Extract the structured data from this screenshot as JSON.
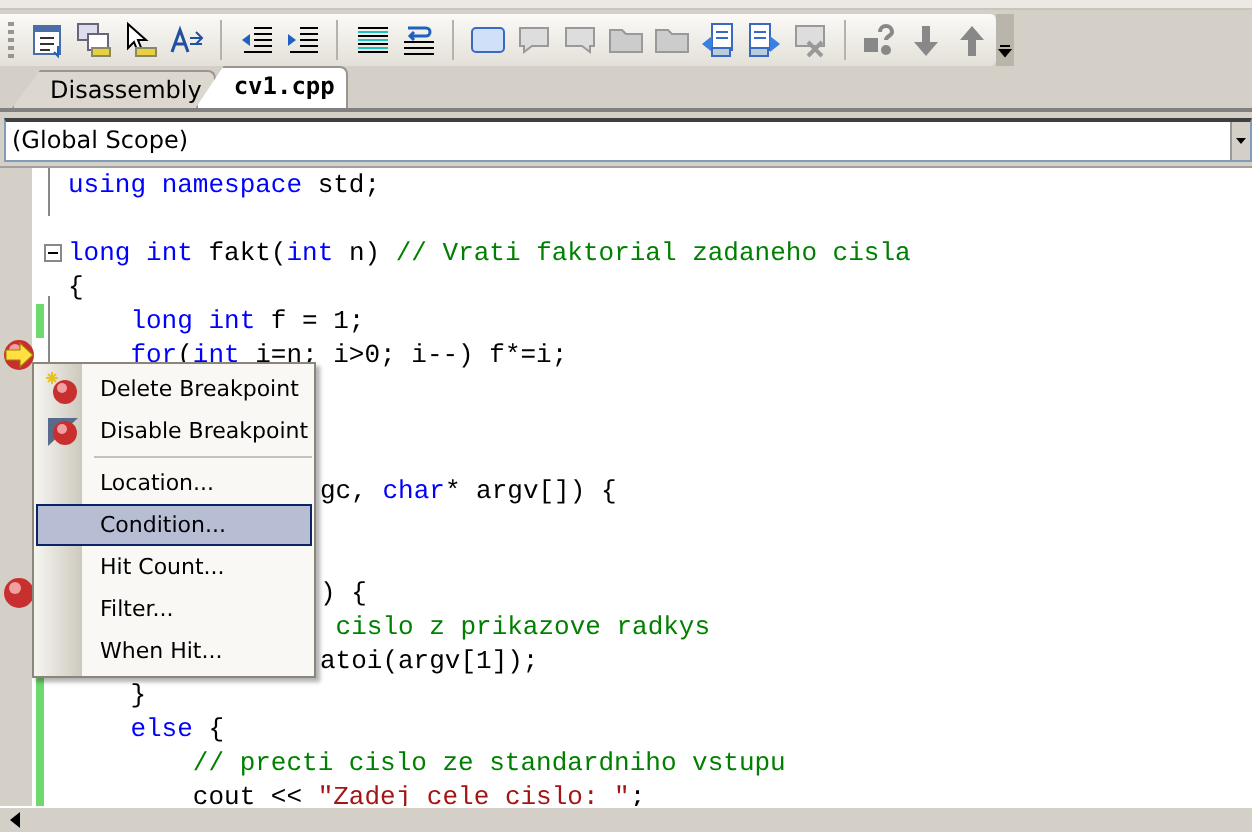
{
  "tabs": [
    {
      "label": "Disassembly",
      "selected": false
    },
    {
      "label": "cv1.cpp",
      "selected": true
    }
  ],
  "scope": {
    "value": "(Global Scope)"
  },
  "code_lines": [
    {
      "tokens": [
        {
          "kind": "keyword",
          "text": "using "
        },
        {
          "kind": "keyword",
          "text": "namespace"
        },
        {
          "kind": "plain",
          "text": " std;"
        }
      ],
      "changed": false,
      "breakpoint": false,
      "current": false
    },
    {
      "changed": false,
      "breakpoint": false,
      "current": false
    },
    {
      "tokens": [
        {
          "kind": "keyword",
          "text": "long "
        },
        {
          "kind": "keyword",
          "text": "int"
        },
        {
          "kind": "plain",
          "text": " fakt("
        },
        {
          "kind": "keyword",
          "text": "int"
        },
        {
          "kind": "plain",
          "text": " n) "
        },
        {
          "kind": "comment",
          "text": "// Vrati faktorial zadaneho cisla"
        }
      ],
      "changed": false,
      "breakpoint": false,
      "current": false,
      "fold": true
    },
    {
      "tokens": [
        {
          "kind": "plain",
          "text": "{"
        }
      ],
      "changed": false,
      "breakpoint": false,
      "current": false
    },
    {
      "tokens": [
        {
          "kind": "keyword",
          "text": "    long "
        },
        {
          "kind": "keyword",
          "text": "int"
        },
        {
          "kind": "plain",
          "text": " f = 1;"
        }
      ],
      "changed": true,
      "breakpoint": false,
      "current": false
    },
    {
      "tokens": [
        {
          "kind": "keyword",
          "text": "    for"
        },
        {
          "kind": "plain",
          "text": "("
        },
        {
          "kind": "keyword",
          "text": "int"
        },
        {
          "kind": "plain",
          "text": " i=n; i>0; i--) f*=i;"
        }
      ],
      "changed": false,
      "breakpoint": true,
      "current": true
    },
    {
      "breakpoint": false,
      "current": false
    },
    {
      "breakpoint": false,
      "current": false
    },
    {
      "breakpoint": false,
      "current": false
    },
    {
      "tokens": [
        {
          "kind": "plain",
          "text": "gc, "
        },
        {
          "kind": "keyword",
          "text": "char"
        },
        {
          "kind": "plain",
          "text": "* argv[]) {"
        }
      ],
      "behind_menu": true,
      "breakpoint": false,
      "current": false
    },
    {
      "breakpoint": false,
      "current": false
    },
    {
      "breakpoint": false,
      "current": false
    },
    {
      "tokens": [
        {
          "kind": "plain",
          "text": ") {"
        }
      ],
      "behind_menu": true,
      "breakpoint": true,
      "current": false
    },
    {
      "tokens": [
        {
          "kind": "comment",
          "text": " cislo z prikazove radkys"
        }
      ],
      "behind_menu": true,
      "breakpoint": false,
      "current": false
    },
    {
      "tokens": [
        {
          "kind": "plain",
          "text": "atoi(argv[1]);"
        }
      ],
      "behind_menu": true,
      "breakpoint": false,
      "current": false
    },
    {
      "tokens": [
        {
          "kind": "plain",
          "text": "    }"
        }
      ],
      "changed": true,
      "breakpoint": false,
      "current": false
    },
    {
      "tokens": [
        {
          "kind": "keyword",
          "text": "    else"
        },
        {
          "kind": "plain",
          "text": " {"
        }
      ],
      "changed": true,
      "breakpoint": false,
      "current": false
    },
    {
      "tokens": [
        {
          "kind": "comment",
          "text": "        // precti cislo ze standardniho vstupu"
        }
      ],
      "changed": true,
      "breakpoint": false,
      "current": false
    },
    {
      "tokens": [
        {
          "kind": "plain",
          "text": "        cout << "
        },
        {
          "kind": "string",
          "text": "\"Zadej cele cislo: \""
        },
        {
          "kind": "plain",
          "text": ";"
        }
      ],
      "changed": true,
      "breakpoint": false,
      "current": false
    }
  ],
  "context_menu": {
    "items": [
      {
        "label": "Delete Breakpoint",
        "kind": "delete",
        "selected": false
      },
      {
        "label": "Disable Breakpoint",
        "kind": "disable",
        "selected": false
      },
      {
        "label": "Location...",
        "kind": "plain",
        "separator_before": true,
        "selected": false
      },
      {
        "label": "Condition...",
        "kind": "plain",
        "selected": true
      },
      {
        "label": "Hit Count...",
        "kind": "plain",
        "selected": false
      },
      {
        "label": "Filter...",
        "kind": "plain",
        "selected": false
      },
      {
        "label": "When Hit...",
        "kind": "plain",
        "selected": false
      }
    ]
  }
}
